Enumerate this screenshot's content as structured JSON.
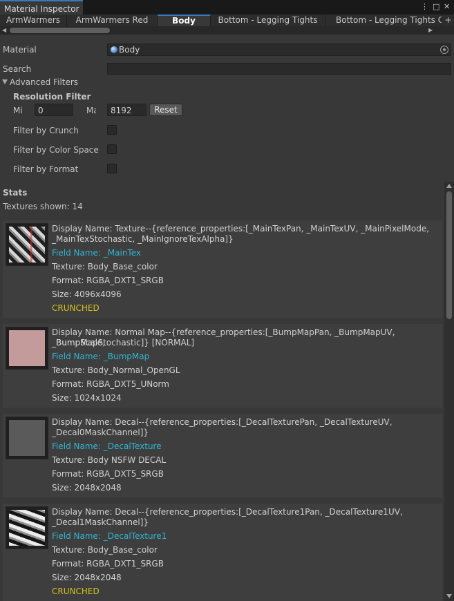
{
  "window": {
    "title": "Material Inspector"
  },
  "tabs": [
    "ArmWarmers",
    "ArmWarmers Red",
    "Body",
    "Bottom - Legging Tights",
    "Bottom - Legging Tights C"
  ],
  "active_tab": "Body",
  "add_tab": "+",
  "material": {
    "label": "Material",
    "value": "Body"
  },
  "search": {
    "label": "Search",
    "value": ""
  },
  "advanced": {
    "label": "Advanced Filters",
    "resolution": {
      "label": "Resolution Filter",
      "min_label": "Mi",
      "min_value": "0",
      "max_label": "Ma",
      "max_value": "8192",
      "reset": "Reset"
    },
    "filters": [
      "Filter by Crunch",
      "Filter by Color Space",
      "Filter by Format"
    ]
  },
  "stats": {
    "label": "Stats",
    "count_text": "Textures shown: 14"
  },
  "textures": [
    {
      "display_line1": "Display Name: Texture--{reference_properties:[_MainTexPan, _MainTexUV, _MainPixelMode,",
      "display_line2": "_MainTexStochastic, _MainIgnoreTexAlpha]}",
      "field": "Field Name: _MainTex",
      "texture": "Texture: Body_Base_color",
      "format": "Format: RGBA_DXT1_SRGB",
      "size": "Size: 4096x4096",
      "badge": "CRUNCHED"
    },
    {
      "display_line1": "Display Name: Normal Map--{reference_properties:[_BumpMapPan, _BumpMapUV, _BumpScale,",
      "display_line2": "_BumpMapStochastic]} [NORMAL]",
      "field": "Field Name: _BumpMap",
      "texture": "Texture: Body_Normal_OpenGL",
      "format": "Format: RGBA_DXT5_UNorm",
      "size": "Size: 1024x1024"
    },
    {
      "display_line1": "Display Name: Decal--{reference_properties:[_DecalTexturePan, _DecalTextureUV,",
      "display_line2": "_Decal0MaskChannel]}",
      "field": "Field Name: _DecalTexture",
      "texture": "Texture: Body NSFW DECAL",
      "format": "Format: RGBA_DXT5_SRGB",
      "size": "Size: 2048x2048"
    },
    {
      "display_line1": "Display Name: Decal--{reference_properties:[_DecalTexture1Pan, _DecalTexture1UV,",
      "display_line2": "_Decal1MaskChannel]}",
      "field": "Field Name: _DecalTexture1",
      "texture": "Texture: Body_Base_color",
      "format": "Format: RGBA_DXT1_SRGB",
      "size": "Size: 2048x2048",
      "badge": "CRUNCHED"
    }
  ],
  "colors": {
    "field_name": "#32b5d3",
    "crunched": "#d4c21c",
    "background": "#383838",
    "tab_accent": "#3a79bb"
  }
}
